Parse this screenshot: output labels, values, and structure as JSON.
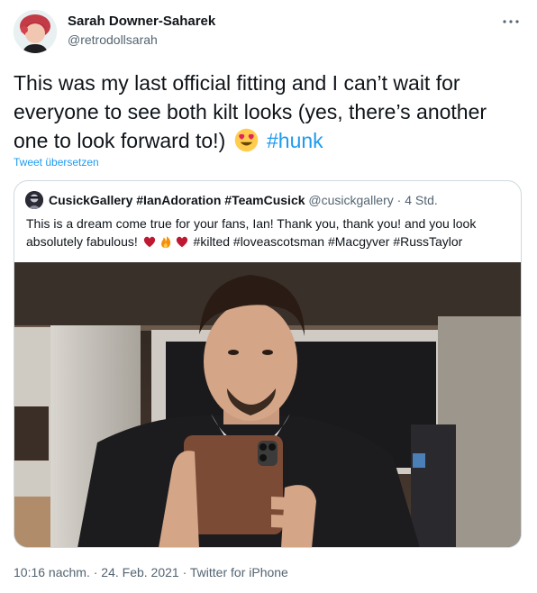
{
  "author": {
    "display_name": "Sarah Downer-Saharek",
    "handle": "@retrodollsarah",
    "avatar_icon": "profile-photo-avatar"
  },
  "menu": {
    "icon": "more-horizontal-icon"
  },
  "tweet": {
    "text": "This was my last official fitting and I can’t wait for everyone to see both kilt looks (yes, there’s another one to look forward to!)",
    "emoji_icon": "heart-eyes-emoji",
    "hashtag": "#hunk",
    "translate_label": "Tweet übersetzen"
  },
  "quoted": {
    "name": "CusickGallery #IanAdoration #TeamCusick",
    "handle": "@cusickgallery",
    "separator": "·",
    "time": "4 Std.",
    "text_lead": "This is a dream come true for your fans, Ian! Thank you, thank you! and you look absolutely fabulous!",
    "emojis": [
      "red-heart-emoji",
      "fire-emoji",
      "red-heart-emoji"
    ],
    "hashtags": "#kilted #loveascotsman #Macgyver #RussTaylor",
    "media_icon": "mirror-selfie-photo"
  },
  "footer": {
    "time": "10:16 nachm.",
    "sep1": "·",
    "date": "24. Feb. 2021",
    "sep2": "·",
    "client": "Twitter for iPhone"
  },
  "colors": {
    "link": "#1d9bf0",
    "secondary_text": "#536471",
    "primary_text": "#0f1419",
    "border": "#cfd9de"
  }
}
